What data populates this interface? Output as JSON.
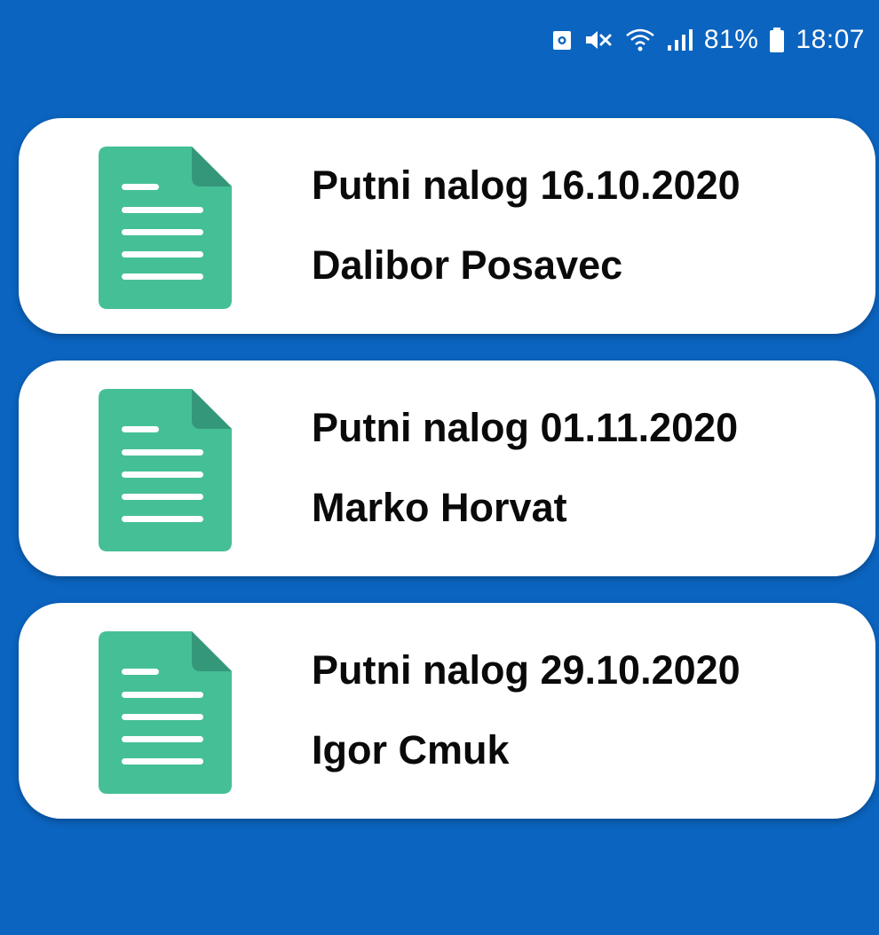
{
  "status_bar": {
    "battery_percent": "81%",
    "time": "18:07",
    "icons": [
      "screenshot-icon",
      "mute-icon",
      "wifi-icon",
      "signal-icon",
      "battery-icon"
    ]
  },
  "orders": [
    {
      "title": "Putni nalog 16.10.2020",
      "name": "Dalibor Posavec",
      "icon": "document-icon"
    },
    {
      "title": "Putni nalog 01.11.2020",
      "name": "Marko Horvat",
      "icon": "document-icon"
    },
    {
      "title": "Putni nalog 29.10.2020",
      "name": "Igor Cmuk",
      "icon": "document-icon"
    }
  ],
  "colors": {
    "background": "#0b64bf",
    "card": "#ffffff",
    "document_icon": "#45bf96",
    "document_fold": "#35977a"
  }
}
